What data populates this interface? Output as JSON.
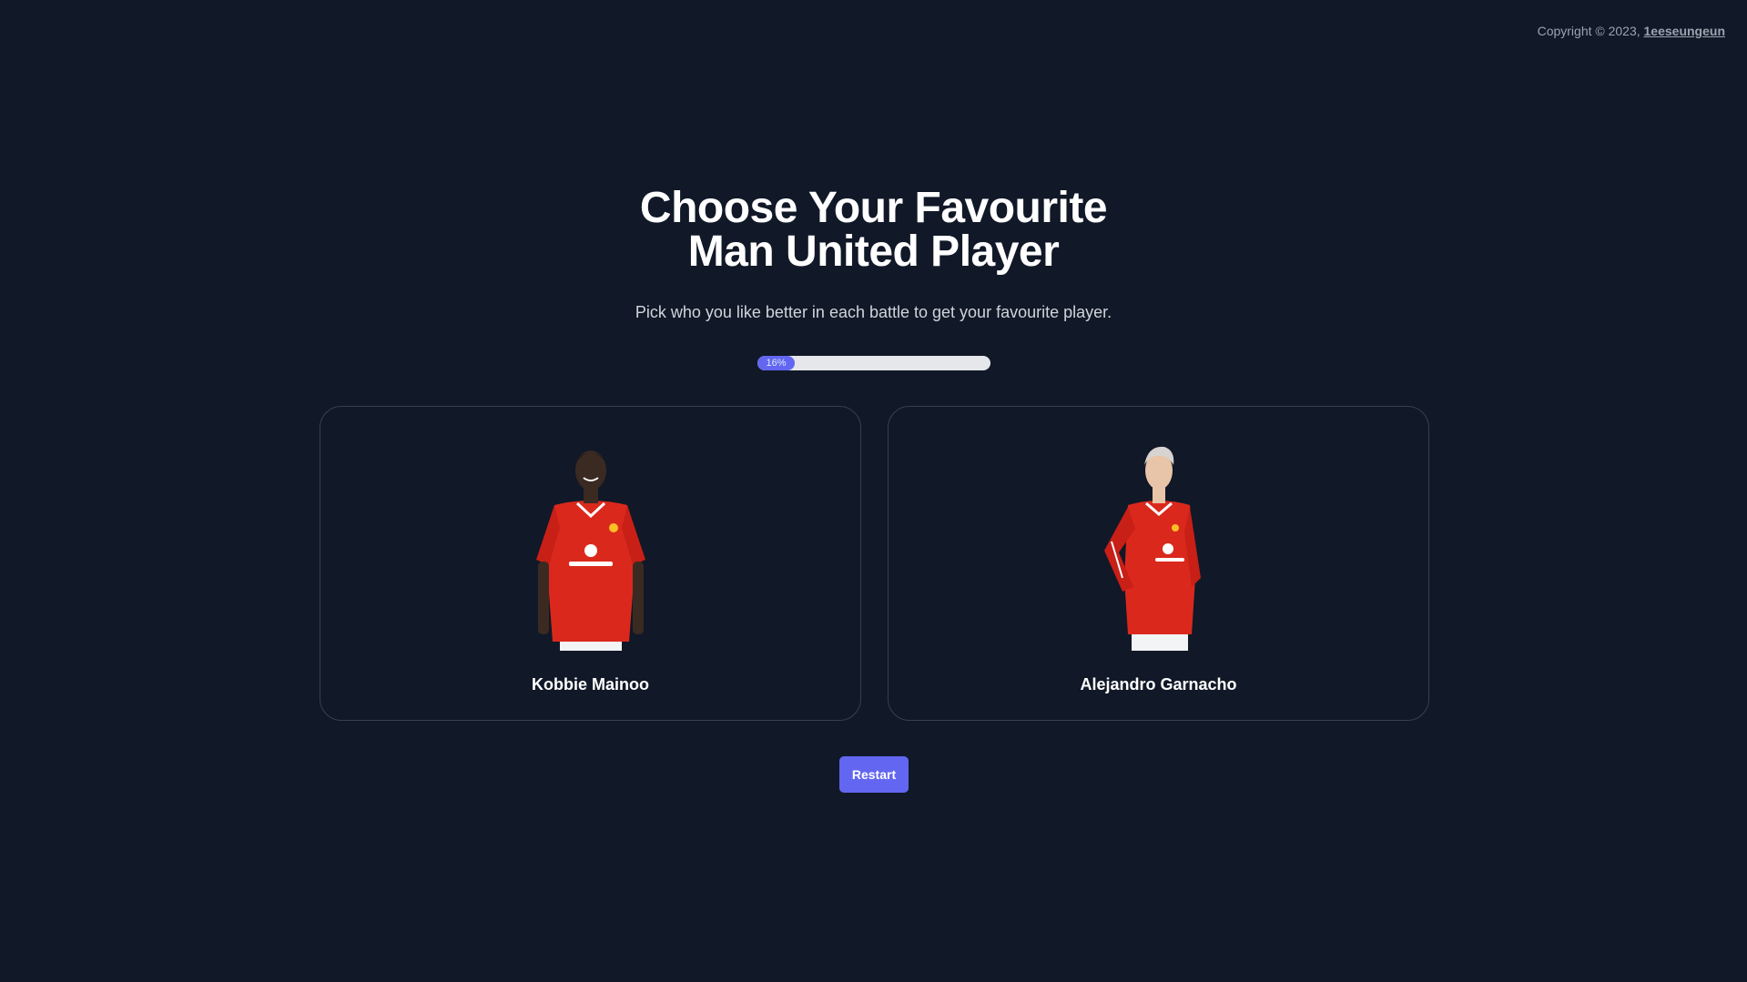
{
  "footer": {
    "copyright_prefix": "Copyright © 2023,",
    "author_link": "1eeseungeun"
  },
  "header": {
    "title_line1": "Choose Your Favourite",
    "title_line2": "Man United Player",
    "subtitle": "Pick who you like better in each battle to get your favourite player."
  },
  "progress": {
    "percent": 16,
    "label": "16%"
  },
  "players": [
    {
      "name": "Kobbie Mainoo",
      "icon": "player-photo"
    },
    {
      "name": "Alejandro Garnacho",
      "icon": "player-photo"
    }
  ],
  "actions": {
    "restart_label": "Restart"
  },
  "colors": {
    "background": "#111827",
    "accent": "#6366f1",
    "card_border": "#374151",
    "track": "#e5e7eb",
    "shirt_red": "#da291c"
  }
}
